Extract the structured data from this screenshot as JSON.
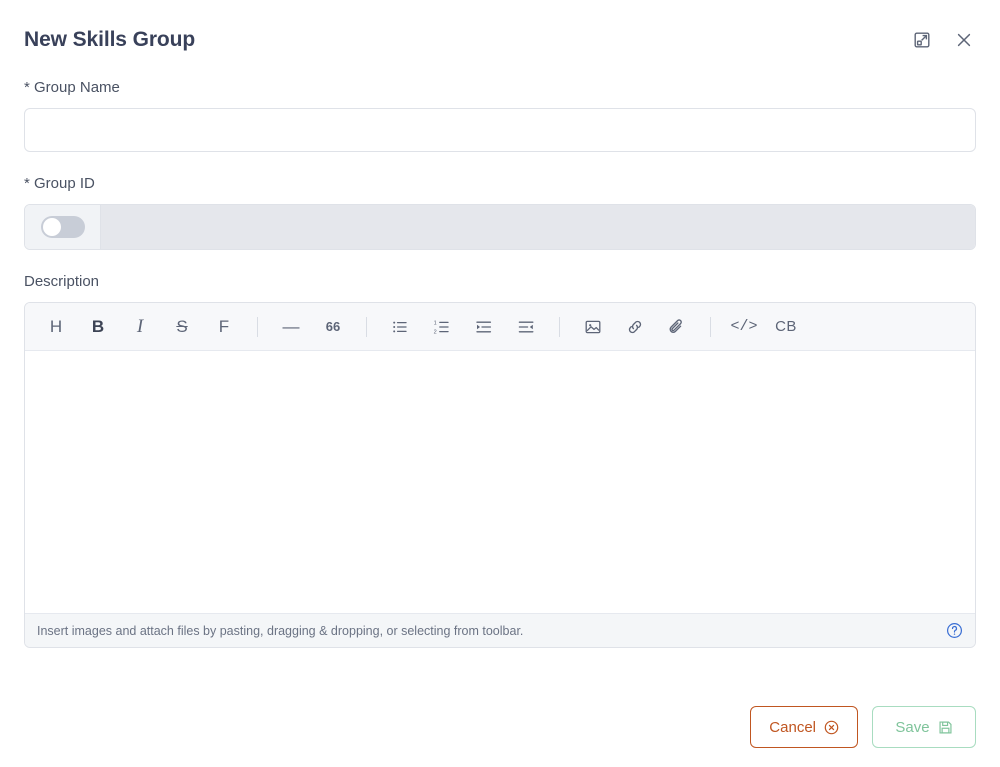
{
  "dialog": {
    "title": "New Skills Group",
    "expand_icon": "expand-icon",
    "close_icon": "close-icon"
  },
  "form": {
    "group_name": {
      "label": "* Group Name",
      "value": "",
      "placeholder": ""
    },
    "group_id": {
      "label": "* Group ID",
      "value": "",
      "placeholder": "",
      "toggle_state": "off",
      "disabled": true
    },
    "description": {
      "label": "Description",
      "value": "",
      "placeholder": ""
    }
  },
  "editor": {
    "toolbar": [
      {
        "name": "heading",
        "glyph": "H",
        "kind": "letter"
      },
      {
        "name": "bold",
        "glyph": "B",
        "kind": "bold"
      },
      {
        "name": "italic",
        "glyph": "I",
        "kind": "italic"
      },
      {
        "name": "strikethrough",
        "glyph": "S",
        "kind": "strike"
      },
      {
        "name": "font",
        "glyph": "F",
        "kind": "letter"
      },
      {
        "name": "separator-1",
        "glyph": "",
        "kind": "sep"
      },
      {
        "name": "horizontal-rule",
        "glyph": "—",
        "kind": "letter"
      },
      {
        "name": "blockquote",
        "glyph": "66",
        "kind": "quote"
      },
      {
        "name": "separator-2",
        "glyph": "",
        "kind": "sep"
      },
      {
        "name": "bullet-list",
        "glyph": "",
        "kind": "svg-bullet"
      },
      {
        "name": "numbered-list",
        "glyph": "",
        "kind": "svg-number"
      },
      {
        "name": "indent",
        "glyph": "",
        "kind": "svg-indent"
      },
      {
        "name": "outdent",
        "glyph": "",
        "kind": "svg-outdent"
      },
      {
        "name": "separator-3",
        "glyph": "",
        "kind": "sep"
      },
      {
        "name": "image",
        "glyph": "",
        "kind": "svg-image"
      },
      {
        "name": "link",
        "glyph": "",
        "kind": "svg-link"
      },
      {
        "name": "attachment",
        "glyph": "",
        "kind": "svg-clip"
      },
      {
        "name": "separator-4",
        "glyph": "",
        "kind": "sep"
      },
      {
        "name": "inline-code",
        "glyph": "</>",
        "kind": "code"
      },
      {
        "name": "code-block",
        "glyph": "CB",
        "kind": "cb"
      }
    ],
    "hint": "Insert images and attach files by pasting, dragging & dropping, or selecting from toolbar.",
    "help_icon": "help-icon"
  },
  "footer": {
    "cancel_label": "Cancel",
    "save_label": "Save"
  },
  "colors": {
    "title": "#39415a",
    "cancel": "#c05621",
    "save": "#7fc49b",
    "help": "#3b6fd4",
    "border": "#dfe2e8",
    "toolbar_bg": "#f7f8fa",
    "disabled_bg": "#e5e7ec"
  }
}
